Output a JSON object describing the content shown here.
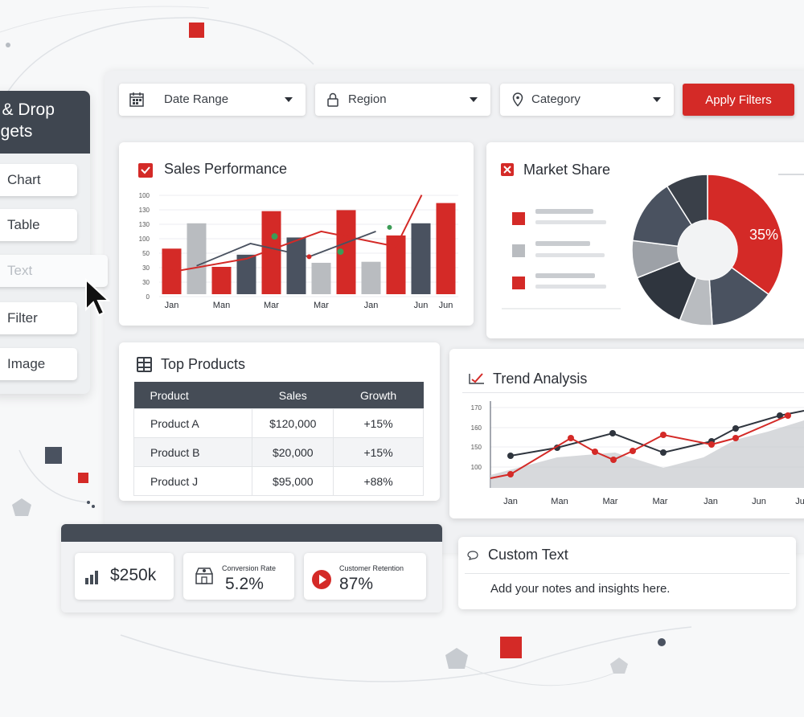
{
  "sidebar": {
    "title_line1": "g & Drop",
    "title_line2": "dgets",
    "items": [
      {
        "label": "Chart"
      },
      {
        "label": "Table"
      },
      {
        "label": "Text"
      },
      {
        "label": "Filter"
      },
      {
        "label": "Image"
      }
    ]
  },
  "filters": {
    "date_range": "Date Range",
    "region": "Region",
    "category": "Category",
    "apply_label": "Apply Filters"
  },
  "sales_performance": {
    "title": "Sales Performance",
    "chart_data": {
      "type": "bar",
      "categories": [
        "Jan",
        "",
        "Man",
        "",
        "Mar",
        "",
        "Mar",
        "",
        "Jan",
        "",
        "Jun",
        "Jun"
      ],
      "tick_labels": [
        "Jan",
        "Man",
        "Mar",
        "Mar",
        "Jan",
        "Jun",
        "Jun"
      ],
      "y_ticks": [
        "0",
        "30",
        "30",
        "50",
        "100",
        "130",
        "130",
        "100"
      ],
      "bars": [
        {
          "value": 45,
          "color": "#d42a27"
        },
        {
          "value": 70,
          "color": "#b9bcc0"
        },
        {
          "value": 27,
          "color": "#d42a27"
        },
        {
          "value": 39,
          "color": "#4a5260"
        },
        {
          "value": 82,
          "color": "#d42a27"
        },
        {
          "value": 56,
          "color": "#4a5260"
        },
        {
          "value": 31,
          "color": "#b9bcc0"
        },
        {
          "value": 83,
          "color": "#d42a27"
        },
        {
          "value": 32,
          "color": "#b9bcc0"
        },
        {
          "value": 58,
          "color": "#d42a27"
        },
        {
          "value": 70,
          "color": "#4a5260"
        },
        {
          "value": 90,
          "color": "#d42a27"
        }
      ],
      "trend_red": [
        22,
        35,
        62,
        47,
        98
      ],
      "trend_dark": [
        28,
        50,
        37,
        62
      ],
      "ylim": [
        0,
        100
      ]
    }
  },
  "market_share": {
    "title": "Market Share",
    "highlight_label": "35%",
    "legend_colors": [
      "#d42a27",
      "#b9bcc0",
      "#d42a27"
    ],
    "chart_data": {
      "type": "pie",
      "slices": [
        {
          "value": 35,
          "color": "#d42a27"
        },
        {
          "value": 14,
          "color": "#4a5260"
        },
        {
          "value": 7,
          "color": "#b9bcc0"
        },
        {
          "value": 13,
          "color": "#2f353e"
        },
        {
          "value": 8,
          "color": "#9da1a7"
        },
        {
          "value": 14,
          "color": "#4a5260"
        },
        {
          "value": 9,
          "color": "#3a4049"
        }
      ],
      "start_fraction_offset": 0
    }
  },
  "top_products": {
    "title": "Top Products",
    "columns": [
      "Product",
      "Sales",
      "Growth"
    ],
    "rows": [
      {
        "product": "Product A",
        "sales": "$120,000",
        "growth": "+15%"
      },
      {
        "product": "Product B",
        "sales": "$20,000",
        "growth": "+15%"
      },
      {
        "product": "Product J",
        "sales": "$95,000",
        "growth": "+88%"
      }
    ]
  },
  "trend_analysis": {
    "title": "Trend Analysis",
    "chart_data": {
      "type": "line",
      "x_labels": [
        "Jan",
        "Man",
        "Mar",
        "Mar",
        "Jan",
        "Jun",
        "Ju"
      ],
      "y_ticks": [
        "170",
        "160",
        "150",
        "100"
      ],
      "series_red": [
        92,
        97,
        142,
        125,
        115,
        126,
        146,
        134,
        142,
        170
      ],
      "series_dark": [
        120,
        130,
        148,
        124,
        138,
        154,
        170,
        176
      ],
      "series_area": [
        96,
        118,
        124,
        105,
        118,
        140,
        150,
        164
      ]
    }
  },
  "kpis": {
    "revenue": {
      "value": "$250k"
    },
    "conversion": {
      "label": "Conversion Rate",
      "value": "5.2%"
    },
    "retention": {
      "label": "Customer Retention",
      "value": "87%"
    }
  },
  "custom_text": {
    "title": "Custom Text",
    "body": "Add your notes and insights here."
  }
}
